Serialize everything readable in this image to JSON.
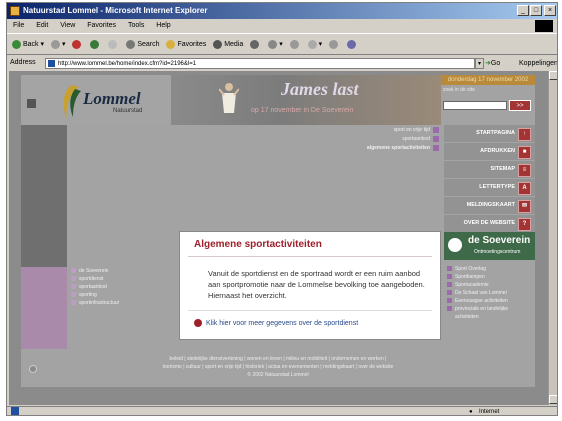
{
  "window": {
    "title": "Natuurstad Lommel - Microsoft Internet Explorer",
    "controls": [
      "_",
      "□",
      "×"
    ]
  },
  "menu": [
    "File",
    "Edit",
    "View",
    "Favorites",
    "Tools",
    "Help"
  ],
  "toolbar": {
    "back": "Back",
    "search": "Search",
    "favorites": "Favorites",
    "media": "Media"
  },
  "address": {
    "label": "Address",
    "url": "http://www.lommel.be/home/index.cfm?id=2196&l=1",
    "go": "Go",
    "links": "Koppelingen"
  },
  "site": {
    "logo": "Lommel",
    "logo_sub": "Natuurstad",
    "banner_title": "James last",
    "banner_sub": "op 17 november in De Soeverein",
    "date": "donderdag 17 november 2002",
    "search_label": "zoek in de site",
    "search_button": ">>",
    "top_nav": [
      "sport en vrije tijd",
      "sportaanbod",
      "algemene sportactiviteiten"
    ],
    "right_nav": [
      {
        "label": "STARTPAGINA",
        "icon": "↑"
      },
      {
        "label": "AFDRUKKEN",
        "icon": "■"
      },
      {
        "label": "SITEMAP",
        "icon": "≡"
      },
      {
        "label": "LETTERTYPE",
        "icon": "A"
      },
      {
        "label": "MELDINGSKAART",
        "icon": "✉"
      },
      {
        "label": "OVER DE WEBSITE",
        "icon": "?"
      }
    ],
    "soeverein": "de Soeverein",
    "soeverein_sub": "Ontmoetingscentrum",
    "left_nav": [
      "de Soeverein",
      "sportdienst",
      "sportaanbod",
      "sporting",
      "sportinfrastructuur"
    ],
    "right_links": [
      "Sport Overlag",
      "Sportkampen",
      "Sportacademie",
      "De Schaal van Lommel",
      "Eeenzaagse activiteiten",
      "provinciale en landelijke",
      "activiteiten"
    ],
    "footer_line1": "beleid | stedelijke dienstverlening | wonen en leven | milieu en mobiliteit | ondernemen en werken |",
    "footer_line2": "toerisme | cultuur | sport en vrije tijd | historiek | actua en evenementen | meldingskaart | over de website",
    "footer_line3": "© 2002 Natuurstad Lommel"
  },
  "dialog": {
    "title": "Algemene sportactiviteiten",
    "body": "Vanuit de sportdienst en de sportraad wordt er een ruim aanbod aan sportpromotie naar de Lommelse bevolking toe aangeboden.  Hiernaast het overzicht.",
    "link": "Klik hier voor meer gegevens over de sportdienst"
  },
  "status": {
    "zone": "Internet"
  }
}
